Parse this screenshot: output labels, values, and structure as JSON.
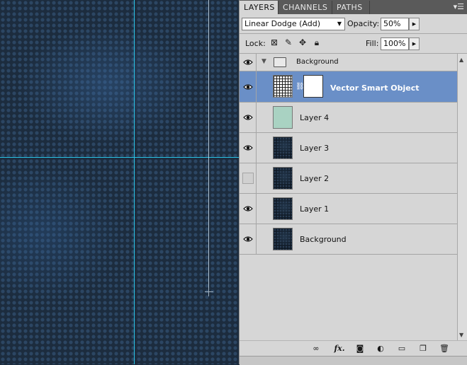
{
  "panel": {
    "tabs": [
      "LAYERS",
      "CHANNELS",
      "PATHS"
    ],
    "menu_icon": "panel-menu-icon"
  },
  "controls": {
    "blend_mode": "Linear Dodge (Add)",
    "opacity_label": "Opacity:",
    "opacity_value": "50%",
    "lock_label": "Lock:",
    "fill_label": "Fill:",
    "fill_value": "100%"
  },
  "group": {
    "name": "Background",
    "expanded": true
  },
  "layers": [
    {
      "name": "Vector Smart Object",
      "visible": true,
      "selected": true,
      "thumb": "grid",
      "has_mask": true
    },
    {
      "name": "Layer 4",
      "visible": true,
      "selected": false,
      "thumb": "green"
    },
    {
      "name": "Layer 3",
      "visible": true,
      "selected": false,
      "thumb": "dark"
    },
    {
      "name": "Layer 2",
      "visible": false,
      "selected": false,
      "thumb": "dark"
    },
    {
      "name": "Layer 1",
      "visible": true,
      "selected": false,
      "thumb": "dark"
    },
    {
      "name": "Background",
      "visible": true,
      "selected": false,
      "thumb": "dark"
    }
  ],
  "footer_icons": [
    "link-layers-icon",
    "fx-icon",
    "add-mask-icon",
    "adjustment-layer-icon",
    "new-group-icon",
    "new-layer-icon",
    "delete-layer-icon"
  ],
  "footer_fx_label": "fx.",
  "colors": {
    "selection": "#6a8fc7",
    "guide": "#29c4e6",
    "panel_bg": "#d6d6d6"
  }
}
